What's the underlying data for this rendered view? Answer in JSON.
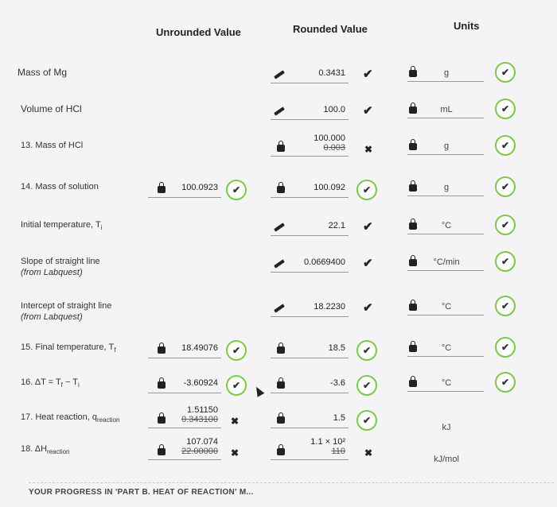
{
  "headers": {
    "unrounded": "Unrounded Value",
    "rounded": "Rounded Value",
    "units": "Units"
  },
  "rows": [
    {
      "label": "Mass of Mg",
      "unrounded": "",
      "rounded": "0.3431",
      "rounded_old": "",
      "unit": "g",
      "rounded_status": "check"
    },
    {
      "label": "Volume of HCl",
      "unrounded": "",
      "rounded": "100.0",
      "rounded_old": "",
      "unit": "mL",
      "rounded_status": "check"
    },
    {
      "label": "13. Mass of HCl",
      "unrounded": "",
      "rounded": "100.000",
      "rounded_old": "0.003",
      "unit": "g",
      "rounded_status": "cross"
    },
    {
      "label": "14. Mass of solution",
      "unrounded": "100.0923",
      "rounded": "100.092",
      "rounded_old": "",
      "unit": "g",
      "rounded_status": "circle"
    },
    {
      "label": "Initial temperature, T",
      "label_sub": "i",
      "unrounded": "",
      "rounded": "22.1",
      "rounded_old": "",
      "unit": "°C",
      "rounded_status": "check"
    },
    {
      "label": "Slope of straight line",
      "label2": "(from Labquest)",
      "unrounded": "",
      "rounded": "0.0669400",
      "rounded_old": "",
      "unit": "°C/min",
      "rounded_status": "check"
    },
    {
      "label": "Intercept of straight line",
      "label2": "(from Labquest)",
      "unrounded": "",
      "rounded": "18.2230",
      "rounded_old": "",
      "unit": "°C",
      "rounded_status": "check"
    },
    {
      "label": "15. Final temperature, T",
      "label_sub": "f",
      "unrounded": "18.49076",
      "rounded": "18.5",
      "rounded_old": "",
      "unit": "°C",
      "rounded_status": "circle"
    },
    {
      "label": "16. ΔT = T",
      "label_sub": "f",
      "label_tail": " − T",
      "label_sub2": "i",
      "unrounded": "-3.60924",
      "rounded": "-3.6",
      "rounded_old": "",
      "unit": "°C",
      "rounded_status": "circle"
    },
    {
      "label": "17. Heat reaction, q",
      "label_sub": "reaction",
      "unrounded": "1.51150",
      "unrounded_old": "0.343100",
      "rounded": "1.5",
      "rounded_old": "",
      "unit": "kJ",
      "rounded_status": "circle"
    },
    {
      "label": "18. ΔH",
      "label_sub": "reaction",
      "unrounded": "107.074",
      "unrounded_old": "22.00000",
      "rounded": "1.1 × 10²",
      "rounded_old": "110",
      "unit": "kJ/mol",
      "rounded_status": "cross"
    }
  ],
  "footer": "YOUR PROGRESS IN 'PART B. HEAT OF REACTION' M..."
}
